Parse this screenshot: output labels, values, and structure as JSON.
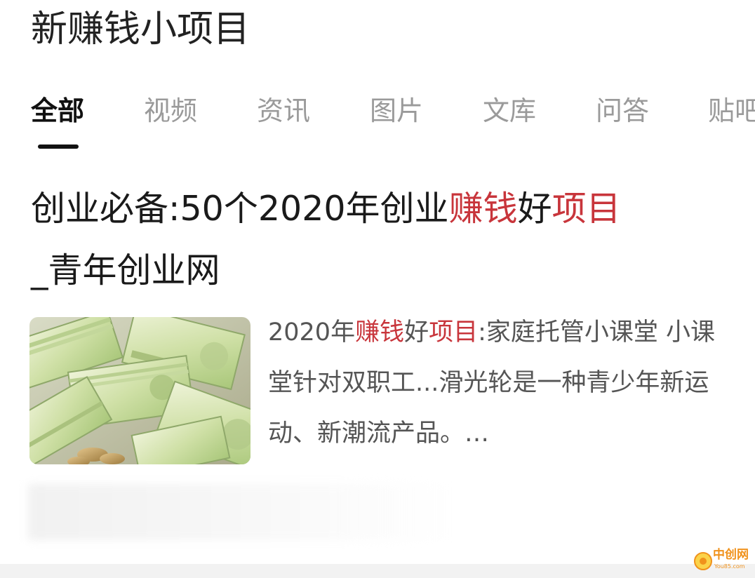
{
  "search": {
    "query": "新赚钱小项目"
  },
  "tabs": [
    {
      "label": "全部",
      "active": true
    },
    {
      "label": "视频",
      "active": false
    },
    {
      "label": "资讯",
      "active": false
    },
    {
      "label": "图片",
      "active": false
    },
    {
      "label": "文库",
      "active": false
    },
    {
      "label": "问答",
      "active": false
    },
    {
      "label": "贴吧",
      "active": false
    }
  ],
  "result": {
    "title_parts": [
      {
        "text": "创业必备:50个2020年创业",
        "highlight": false
      },
      {
        "text": "赚钱",
        "highlight": true
      },
      {
        "text": "好",
        "highlight": false
      },
      {
        "text": "项目",
        "highlight": true
      },
      {
        "text": "_青年创业网",
        "highlight": false
      }
    ],
    "thumbnail_icon": "money-banknotes-image",
    "snippet_parts": [
      {
        "text": "2020年",
        "highlight": false
      },
      {
        "text": "赚钱",
        "highlight": true
      },
      {
        "text": "好",
        "highlight": false
      },
      {
        "text": "项目",
        "highlight": true
      },
      {
        "text": ":家庭托管小课堂 小课堂针对双职工...滑光轮是一种青少年新运动、新潮流产品。…",
        "highlight": false
      }
    ]
  },
  "watermark": {
    "text": "中创网",
    "subtext": "You85.com"
  },
  "colors": {
    "highlight": "#c8353b",
    "tab_active": "#111111",
    "tab_inactive": "#9a9a9a",
    "snippet_text": "#555555",
    "watermark_orange": "#f0921c"
  }
}
